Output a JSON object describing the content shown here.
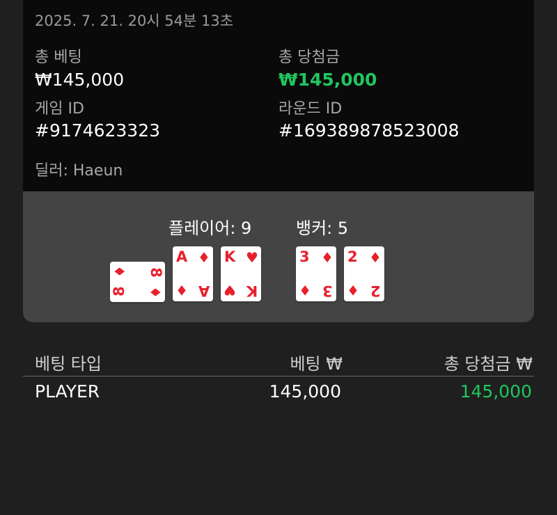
{
  "round": {
    "timestamp": "2025. 7. 21. 20시 54분 13초",
    "total_bet_label": "총 베팅",
    "total_bet_value": "₩145,000",
    "total_win_label": "총 당첨금",
    "total_win_value": "₩145,000",
    "game_id_label": "게임 ID",
    "game_id_value": "#9174623323",
    "round_id_label": "라운드 ID",
    "round_id_value": "#169389878523008",
    "dealer": "딜러: Haeun"
  },
  "hands": {
    "player_label": "플레이어: 9",
    "banker_label": "뱅커: 5",
    "player_cards": [
      {
        "rank": "8",
        "suit": "diamond-icon",
        "suit_glyph": "♦",
        "rotated": true
      },
      {
        "rank": "A",
        "suit": "diamond-icon",
        "suit_glyph": "♦",
        "rotated": false
      },
      {
        "rank": "K",
        "suit": "heart-icon",
        "suit_glyph": "♥",
        "rotated": false
      }
    ],
    "banker_cards": [
      {
        "rank": "3",
        "suit": "diamond-icon",
        "suit_glyph": "♦",
        "rotated": false
      },
      {
        "rank": "2",
        "suit": "diamond-icon",
        "suit_glyph": "♦",
        "rotated": false
      }
    ],
    "card_color": "#e8202c"
  },
  "bets_table": {
    "headers": [
      "베팅 타입",
      "베팅 ₩",
      "총 당첨금 ₩"
    ],
    "rows": [
      {
        "type": "PLAYER",
        "bet": "145,000",
        "win": "145,000"
      }
    ]
  },
  "colors": {
    "win_green": "#22c55e",
    "card_bg": "#0a0a0a",
    "panel_bg": "#444444",
    "page_bg": "#1f1f1f"
  }
}
